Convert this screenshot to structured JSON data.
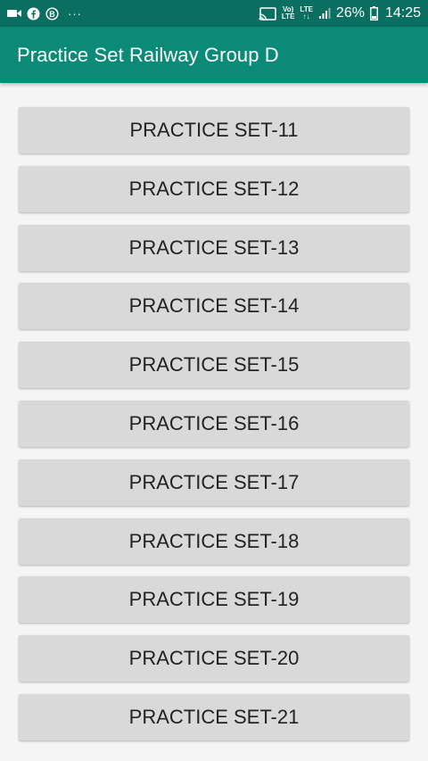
{
  "status_bar": {
    "left_icons": [
      "video-icon",
      "facebook-icon",
      "b-badge-icon"
    ],
    "more_dots": "···",
    "volte_top": "Vo)",
    "volte_bottom": "LTE",
    "lte_top": "LTE",
    "lte_bottom": "↑↓",
    "battery_percent": "26%",
    "time": "14:25"
  },
  "app_bar": {
    "title": "Practice Set Railway Group D",
    "color": "#0b8a78"
  },
  "buttons": [
    "PRACTICE SET-11",
    "PRACTICE SET-12",
    "PRACTICE SET-13",
    "PRACTICE SET-14",
    "PRACTICE SET-15",
    "PRACTICE SET-16",
    "PRACTICE SET-17",
    "PRACTICE SET-18",
    "PRACTICE SET-19",
    "PRACTICE SET-20",
    "PRACTICE SET-21"
  ]
}
